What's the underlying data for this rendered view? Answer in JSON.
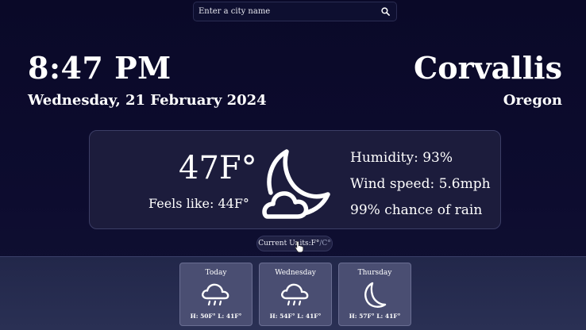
{
  "search": {
    "placeholder": "Enter a city name",
    "icon": "search-icon"
  },
  "time": "8:47 PM",
  "date": "Wednesday, 21 February 2024",
  "location": {
    "city": "Corvallis",
    "region": "Oregon"
  },
  "current": {
    "temperature": "47F°",
    "feels_like": "Feels like: 44F°",
    "condition_icon": "moon-cloud-icon",
    "humidity": "Humidity: 93%",
    "wind": "Wind speed: 5.6mph",
    "rain": "99% chance of rain"
  },
  "units": {
    "prefix": "Current Units: ",
    "active": "F°",
    "separator": "/",
    "inactive": "C°"
  },
  "forecast": [
    {
      "day": "Today",
      "icon": "rain-cloud-icon",
      "hl": "H: 50F° L: 41F°"
    },
    {
      "day": "Wednesday",
      "icon": "rain-cloud-icon",
      "hl": "H: 54F° L: 41F°"
    },
    {
      "day": "Thursday",
      "icon": "moon-icon",
      "hl": "H: 57F° L: 41F°"
    }
  ]
}
